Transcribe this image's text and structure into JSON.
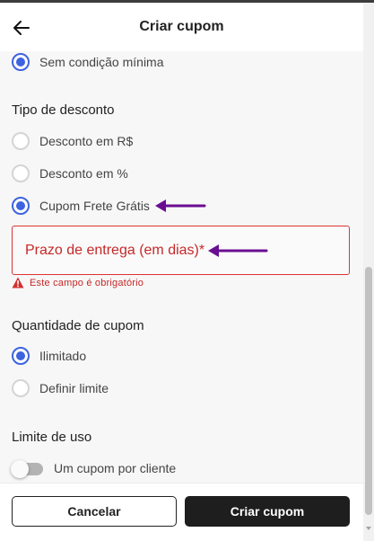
{
  "header": {
    "title": "Criar cupom"
  },
  "minimum": {
    "option_label": "Sem condição mínima"
  },
  "discount_type": {
    "title": "Tipo de desconto",
    "options": [
      {
        "label": "Desconto em R$",
        "selected": false
      },
      {
        "label": "Desconto em %",
        "selected": false
      },
      {
        "label": "Cupom Frete Grátis",
        "selected": true
      }
    ]
  },
  "delivery_field": {
    "label": "Prazo de entrega (em dias)*",
    "error": "Este campo é obrigatório"
  },
  "quantity": {
    "title": "Quantidade de cupom",
    "options": [
      {
        "label": "Ilimitado",
        "selected": true
      },
      {
        "label": "Definir limite",
        "selected": false
      }
    ]
  },
  "usage_limit": {
    "title": "Limite de uso",
    "toggle_label": "Um cupom por cliente",
    "toggle_on": false
  },
  "footer": {
    "cancel_label": "Cancelar",
    "create_label": "Criar cupom"
  },
  "colors": {
    "accent": "#3d63e0",
    "error": "#c62828",
    "annotation_arrow": "#6a0d91",
    "primary_button": "#1e1e1e"
  },
  "icons": {
    "back": "arrow-left-icon",
    "error": "warning-triangle-icon",
    "annotation": "arrow-left-annotation"
  }
}
